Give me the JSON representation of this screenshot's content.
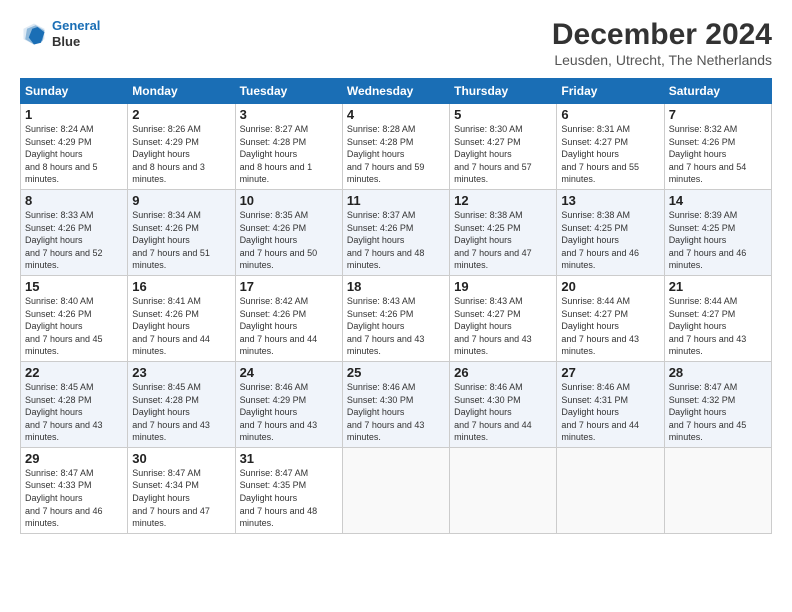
{
  "logo": {
    "line1": "General",
    "line2": "Blue"
  },
  "title": "December 2024",
  "subtitle": "Leusden, Utrecht, The Netherlands",
  "days_header": [
    "Sunday",
    "Monday",
    "Tuesday",
    "Wednesday",
    "Thursday",
    "Friday",
    "Saturday"
  ],
  "weeks": [
    [
      {
        "day": "1",
        "sunrise": "8:24 AM",
        "sunset": "4:29 PM",
        "daylight": "8 hours and 5 minutes."
      },
      {
        "day": "2",
        "sunrise": "8:26 AM",
        "sunset": "4:29 PM",
        "daylight": "8 hours and 3 minutes."
      },
      {
        "day": "3",
        "sunrise": "8:27 AM",
        "sunset": "4:28 PM",
        "daylight": "8 hours and 1 minute."
      },
      {
        "day": "4",
        "sunrise": "8:28 AM",
        "sunset": "4:28 PM",
        "daylight": "7 hours and 59 minutes."
      },
      {
        "day": "5",
        "sunrise": "8:30 AM",
        "sunset": "4:27 PM",
        "daylight": "7 hours and 57 minutes."
      },
      {
        "day": "6",
        "sunrise": "8:31 AM",
        "sunset": "4:27 PM",
        "daylight": "7 hours and 55 minutes."
      },
      {
        "day": "7",
        "sunrise": "8:32 AM",
        "sunset": "4:26 PM",
        "daylight": "7 hours and 54 minutes."
      }
    ],
    [
      {
        "day": "8",
        "sunrise": "8:33 AM",
        "sunset": "4:26 PM",
        "daylight": "7 hours and 52 minutes."
      },
      {
        "day": "9",
        "sunrise": "8:34 AM",
        "sunset": "4:26 PM",
        "daylight": "7 hours and 51 minutes."
      },
      {
        "day": "10",
        "sunrise": "8:35 AM",
        "sunset": "4:26 PM",
        "daylight": "7 hours and 50 minutes."
      },
      {
        "day": "11",
        "sunrise": "8:37 AM",
        "sunset": "4:26 PM",
        "daylight": "7 hours and 48 minutes."
      },
      {
        "day": "12",
        "sunrise": "8:38 AM",
        "sunset": "4:25 PM",
        "daylight": "7 hours and 47 minutes."
      },
      {
        "day": "13",
        "sunrise": "8:38 AM",
        "sunset": "4:25 PM",
        "daylight": "7 hours and 46 minutes."
      },
      {
        "day": "14",
        "sunrise": "8:39 AM",
        "sunset": "4:25 PM",
        "daylight": "7 hours and 46 minutes."
      }
    ],
    [
      {
        "day": "15",
        "sunrise": "8:40 AM",
        "sunset": "4:26 PM",
        "daylight": "7 hours and 45 minutes."
      },
      {
        "day": "16",
        "sunrise": "8:41 AM",
        "sunset": "4:26 PM",
        "daylight": "7 hours and 44 minutes."
      },
      {
        "day": "17",
        "sunrise": "8:42 AM",
        "sunset": "4:26 PM",
        "daylight": "7 hours and 44 minutes."
      },
      {
        "day": "18",
        "sunrise": "8:43 AM",
        "sunset": "4:26 PM",
        "daylight": "7 hours and 43 minutes."
      },
      {
        "day": "19",
        "sunrise": "8:43 AM",
        "sunset": "4:27 PM",
        "daylight": "7 hours and 43 minutes."
      },
      {
        "day": "20",
        "sunrise": "8:44 AM",
        "sunset": "4:27 PM",
        "daylight": "7 hours and 43 minutes."
      },
      {
        "day": "21",
        "sunrise": "8:44 AM",
        "sunset": "4:27 PM",
        "daylight": "7 hours and 43 minutes."
      }
    ],
    [
      {
        "day": "22",
        "sunrise": "8:45 AM",
        "sunset": "4:28 PM",
        "daylight": "7 hours and 43 minutes."
      },
      {
        "day": "23",
        "sunrise": "8:45 AM",
        "sunset": "4:28 PM",
        "daylight": "7 hours and 43 minutes."
      },
      {
        "day": "24",
        "sunrise": "8:46 AM",
        "sunset": "4:29 PM",
        "daylight": "7 hours and 43 minutes."
      },
      {
        "day": "25",
        "sunrise": "8:46 AM",
        "sunset": "4:30 PM",
        "daylight": "7 hours and 43 minutes."
      },
      {
        "day": "26",
        "sunrise": "8:46 AM",
        "sunset": "4:30 PM",
        "daylight": "7 hours and 44 minutes."
      },
      {
        "day": "27",
        "sunrise": "8:46 AM",
        "sunset": "4:31 PM",
        "daylight": "7 hours and 44 minutes."
      },
      {
        "day": "28",
        "sunrise": "8:47 AM",
        "sunset": "4:32 PM",
        "daylight": "7 hours and 45 minutes."
      }
    ],
    [
      {
        "day": "29",
        "sunrise": "8:47 AM",
        "sunset": "4:33 PM",
        "daylight": "7 hours and 46 minutes."
      },
      {
        "day": "30",
        "sunrise": "8:47 AM",
        "sunset": "4:34 PM",
        "daylight": "7 hours and 47 minutes."
      },
      {
        "day": "31",
        "sunrise": "8:47 AM",
        "sunset": "4:35 PM",
        "daylight": "7 hours and 48 minutes."
      },
      null,
      null,
      null,
      null
    ]
  ]
}
